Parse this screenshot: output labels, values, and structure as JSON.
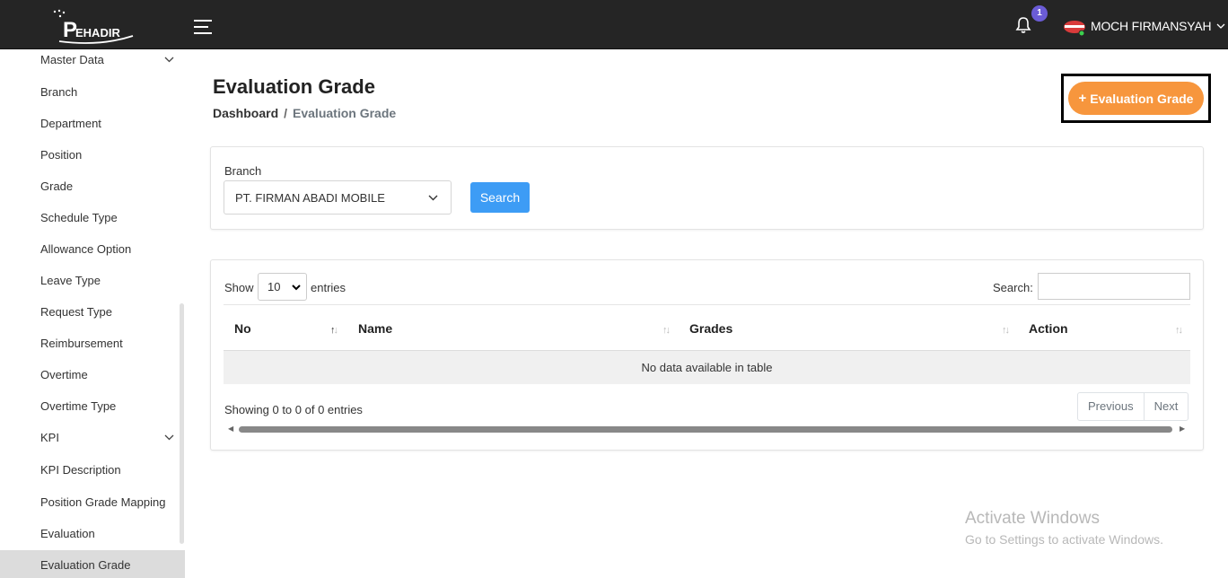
{
  "header": {
    "logo_text": "EHADIR",
    "notification_count": "1",
    "user_name": "MOCH FIRMANSYAH"
  },
  "sidebar": {
    "items": [
      {
        "label": "Master Data",
        "has_chevron": true
      },
      {
        "label": "Branch"
      },
      {
        "label": "Department"
      },
      {
        "label": "Position"
      },
      {
        "label": "Grade"
      },
      {
        "label": "Schedule Type"
      },
      {
        "label": "Allowance Option"
      },
      {
        "label": "Leave Type"
      },
      {
        "label": "Request Type"
      },
      {
        "label": "Reimbursement"
      },
      {
        "label": "Overtime"
      },
      {
        "label": "Overtime Type"
      },
      {
        "label": "KPI",
        "has_chevron": true
      },
      {
        "label": "KPI Description"
      },
      {
        "label": "Position Grade Mapping"
      },
      {
        "label": "Evaluation"
      },
      {
        "label": "Evaluation Grade",
        "active": true
      }
    ]
  },
  "page": {
    "title": "Evaluation Grade",
    "breadcrumb": {
      "home": "Dashboard",
      "separator": "/",
      "current": "Evaluation Grade"
    },
    "add_button": {
      "plus": "+",
      "label": "Evaluation Grade"
    }
  },
  "filter": {
    "label": "Branch",
    "selected": "PT. FIRMAN ABADI MOBILE",
    "search_button": "Search"
  },
  "table": {
    "show_label": "Show",
    "entries_value": "10",
    "entries_label": "entries",
    "search_label": "Search:",
    "columns": [
      "No",
      "Name",
      "Grades",
      "Action"
    ],
    "empty_message": "No data available in table",
    "info": "Showing 0 to 0 of 0 entries",
    "pagination": {
      "previous": "Previous",
      "next": "Next"
    }
  },
  "watermark": {
    "title": "Activate Windows",
    "subtitle": "Go to Settings to activate Windows."
  },
  "colors": {
    "topbar": "#252525",
    "accent_orange": "#f7963d",
    "primary_blue": "#3d9cf5",
    "badge_purple": "#6b5cd6"
  },
  "icons": [
    "logo",
    "hamburger-icon",
    "bell-icon",
    "avatar",
    "chevron-down-icon",
    "sort-icon"
  ]
}
